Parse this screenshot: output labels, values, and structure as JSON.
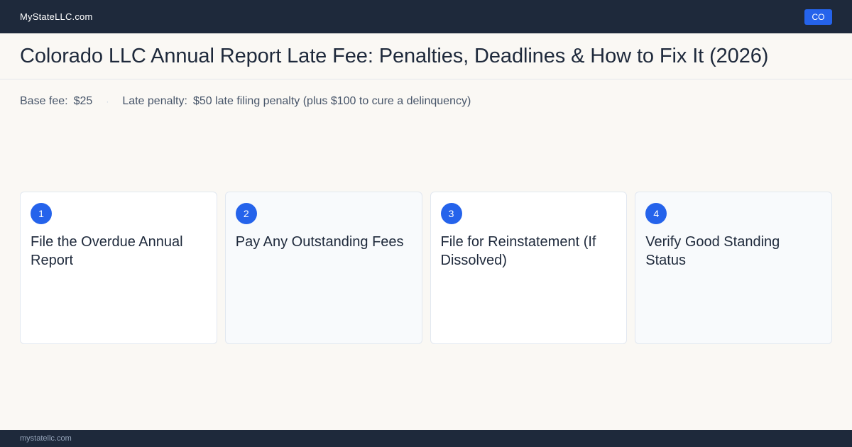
{
  "header": {
    "brand": "MyStateLLC.com",
    "state_badge": "CO"
  },
  "page": {
    "title": "Colorado LLC Annual Report Late Fee: Penalties, Deadlines & How to Fix It (2026)"
  },
  "fees": {
    "base_label": "Base fee:",
    "base_value": "$25",
    "separator": "·",
    "late_label": "Late penalty:",
    "late_value": "$50 late filing penalty (plus $100 to cure a delinquency)"
  },
  "steps": [
    {
      "number": "1",
      "title": "File the Overdue Annual Report"
    },
    {
      "number": "2",
      "title": "Pay Any Outstanding Fees"
    },
    {
      "number": "3",
      "title": "File for Reinstatement (If Dissolved)"
    },
    {
      "number": "4",
      "title": "Verify Good Standing Status"
    }
  ],
  "footer": {
    "domain": "mystatellc.com"
  },
  "colors": {
    "nav_bg": "#1e293b",
    "accent": "#2563eb",
    "page_bg": "#faf8f4"
  }
}
